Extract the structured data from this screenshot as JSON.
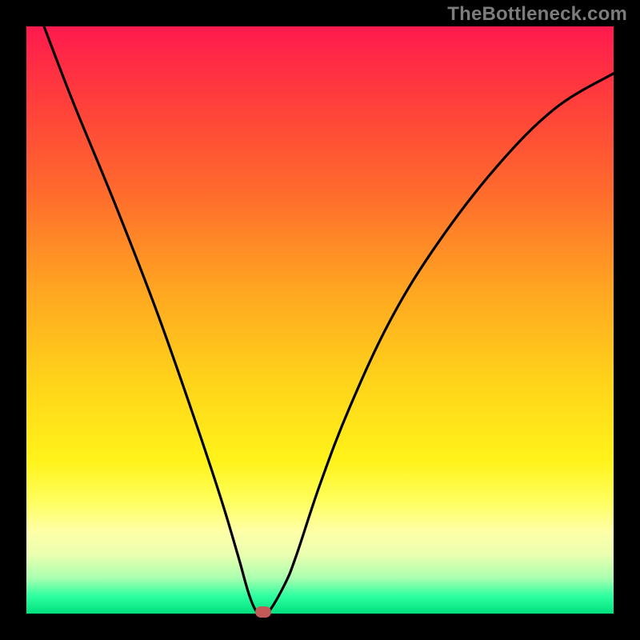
{
  "watermark": "TheBottleneck.com",
  "chart_data": {
    "type": "line",
    "title": "",
    "xlabel": "",
    "ylabel": "",
    "xlim": [
      0,
      100
    ],
    "ylim": [
      0,
      100
    ],
    "series": [
      {
        "name": "bottleneck-curve",
        "x": [
          3,
          8,
          15,
          22,
          28,
          33,
          36,
          38,
          39.5,
          41,
          44,
          46,
          50,
          55,
          62,
          70,
          80,
          90,
          100
        ],
        "values": [
          100,
          87,
          70,
          52,
          35,
          20,
          10,
          3,
          0,
          0,
          5,
          10,
          22,
          35,
          50,
          63,
          76,
          86,
          92
        ]
      }
    ],
    "marker": {
      "x": 40.3,
      "y": 0
    },
    "background_gradient": {
      "top": "#ff1a4e",
      "mid": "#ffd21a",
      "bottom": "#00e07e"
    }
  }
}
